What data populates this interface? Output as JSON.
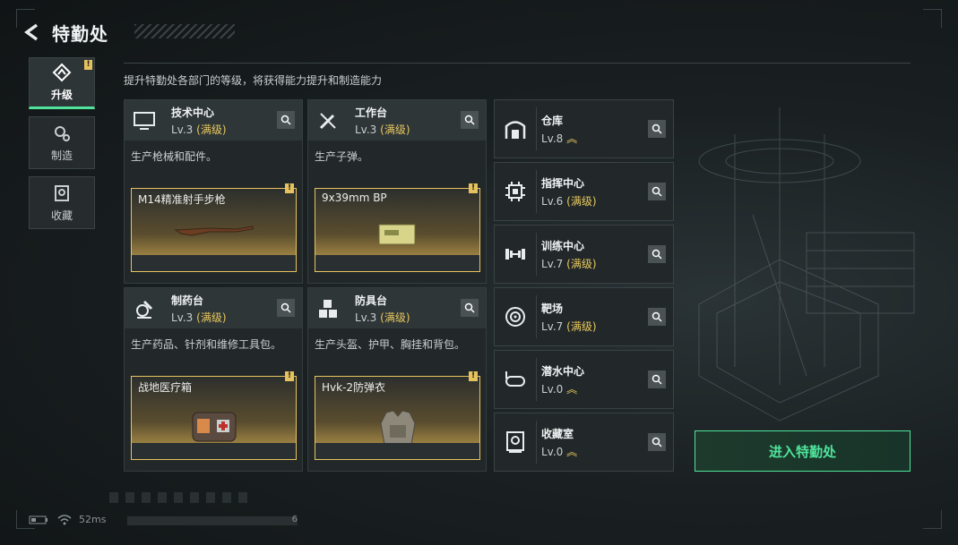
{
  "header": {
    "title": "特勤处",
    "subtitle": "提升特勤处各部门的等级，将获得能力提升和制造能力"
  },
  "side_tabs": [
    {
      "label": "升级",
      "active": true,
      "badge": "!"
    },
    {
      "label": "制造",
      "active": false
    },
    {
      "label": "收藏",
      "active": false
    }
  ],
  "workshops": [
    {
      "name": "技术中心",
      "level": "Lv.3",
      "maxed": "(满级)",
      "desc": "生产枪械和配件。",
      "item": "M14精准射手步枪",
      "badge": "!"
    },
    {
      "name": "工作台",
      "level": "Lv.3",
      "maxed": "(满级)",
      "desc": "生产子弹。",
      "item": "9x39mm BP",
      "badge": "!"
    },
    {
      "name": "制药台",
      "level": "Lv.3",
      "maxed": "(满级)",
      "desc": "生产药品、针剂和维修工具包。",
      "item": "战地医疗箱",
      "badge": "!"
    },
    {
      "name": "防具台",
      "level": "Lv.3",
      "maxed": "(满级)",
      "desc": "生产头盔、护甲、胸挂和背包。",
      "item": "Hvk-2防弹衣",
      "badge": "!"
    }
  ],
  "rooms": [
    {
      "name": "仓库",
      "level": "Lv.8",
      "maxed": "",
      "upgradable": true
    },
    {
      "name": "指挥中心",
      "level": "Lv.6",
      "maxed": "(满级)",
      "upgradable": false
    },
    {
      "name": "训练中心",
      "level": "Lv.7",
      "maxed": "(满级)",
      "upgradable": false
    },
    {
      "name": "靶场",
      "level": "Lv.7",
      "maxed": "(满级)",
      "upgradable": false
    },
    {
      "name": "潜水中心",
      "level": "Lv.0",
      "maxed": "",
      "upgradable": true
    },
    {
      "name": "收藏室",
      "level": "Lv.0",
      "maxed": "",
      "upgradable": true
    }
  ],
  "enter_button": "进入特勤处",
  "status": {
    "ping": "52ms",
    "progress_text": "6"
  },
  "colors": {
    "accent_green": "#4fe39b",
    "gold": "#e8c85e"
  }
}
